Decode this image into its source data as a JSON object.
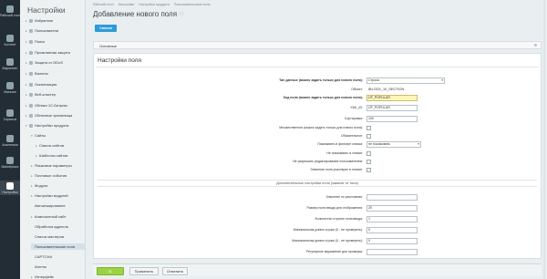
{
  "leftbar": {
    "items": [
      {
        "label": "Рабочий стол"
      },
      {
        "label": "Контент"
      },
      {
        "label": "Маркетинг"
      },
      {
        "label": "Магазин"
      },
      {
        "label": "Сервисы"
      },
      {
        "label": "Аналитика"
      },
      {
        "label": "Marketplace"
      },
      {
        "label": "Настройки"
      }
    ]
  },
  "menu": {
    "title": "Настройки",
    "items": [
      {
        "label": "Избранное"
      },
      {
        "label": "Пользователи"
      },
      {
        "label": "Поиск"
      },
      {
        "label": "Проактивная защита"
      },
      {
        "label": "Защита от DDoS"
      },
      {
        "label": "Валюты"
      },
      {
        "label": "Локализация"
      },
      {
        "label": "Веб-кластер"
      },
      {
        "label": "Облако 1С-Битрикс"
      },
      {
        "label": "Облачные хранилища"
      },
      {
        "label": "Настройки продукта"
      },
      {
        "label": "Сайты"
      },
      {
        "label": "Список сайтов"
      },
      {
        "label": "Шаблоны сайтов"
      },
      {
        "label": "Языковые параметры"
      },
      {
        "label": "Почтовые события"
      },
      {
        "label": "Модули"
      },
      {
        "label": "Настройки модулей"
      },
      {
        "label": "Автокешированее"
      },
      {
        "label": "Композитный сайт"
      },
      {
        "label": "Обработка адресов"
      },
      {
        "label": "Список мастеров"
      },
      {
        "label": "Пользовательские поля"
      },
      {
        "label": "CAPTCHA"
      },
      {
        "label": "Агенты"
      },
      {
        "label": "Интерфейс"
      }
    ]
  },
  "breadcrumbs": [
    "Рабочий стол",
    "Настройки",
    "Настройки продукта",
    "Пользовательские поля"
  ],
  "page": {
    "title": "Добавление нового поля",
    "list_button": "Список"
  },
  "tabs": {
    "active": "Основные"
  },
  "section_title": "Настройки поля",
  "fields": {
    "type_label": "Тип данных (можно задать только для нового поля):",
    "type_value": "Строка",
    "object_label": "Объект:",
    "object_value": "IBLOCK_10_SECTION",
    "code_label": "Код поля (можно задать только для нового поля):",
    "code_value": "UF_POPULAR",
    "xml_label": "XML_ID:",
    "xml_value": "UF_POPULAR",
    "sort_label": "Сортировка:",
    "sort_value": "100",
    "multiple_label": "Множественное (можно задать только для нового поля):",
    "required_label": "Обязательное:",
    "filter_label": "Показывать в фильтре списка:",
    "filter_value": "не показывать",
    "nolist_label": "Не показывать в списке:",
    "noedit_label": "Не разрешать редактирование пользователем:",
    "search_label": "Значения поля участвуют в поиске:"
  },
  "extra": {
    "heading": "Дополнительные настройки поля (зависят от типа)",
    "default_label": "Значение по умолчанию:",
    "default_value": "",
    "size_label": "Размер поля ввода для отображения:",
    "size_value": "20",
    "rows_label": "Количество строчек поля ввода:",
    "rows_value": "1",
    "minlen_label": "Минимальная длина строки (0 - не проверять):",
    "minlen_value": "0",
    "maxlen_label": "Максимальная длина строки (0 - не проверять):",
    "maxlen_value": "0",
    "regexp_label": "Регулярное выражение для проверки:",
    "regexp_value": ""
  },
  "footer": {
    "save": "С",
    "apply": "Применить",
    "cancel": "Отменить"
  }
}
